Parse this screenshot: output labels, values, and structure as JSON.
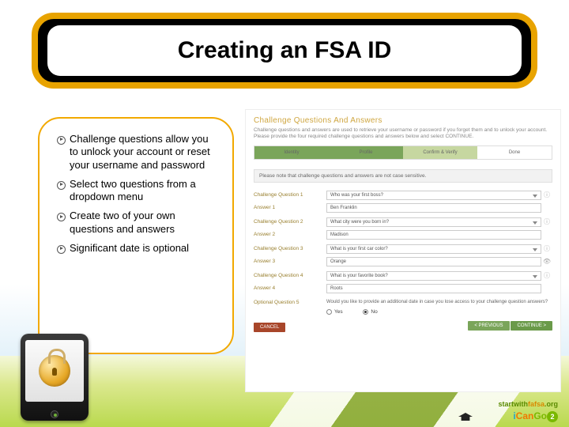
{
  "title": "Creating an FSA ID",
  "bullets": [
    "Challenge questions allow you to unlock your account or reset your username and password",
    "Select two questions from a dropdown menu",
    "Create two of your own questions and answers",
    "Significant date is optional"
  ],
  "panel": {
    "heading": "Challenge Questions And Answers",
    "blurb": "Challenge questions and answers are used to retrieve your username or password if you forget them and to unlock your account. Please provide the four required challenge questions and answers below and select CONTINUE.",
    "steps": [
      "Identity",
      "Profile",
      "Confirm & Verify",
      "Done"
    ],
    "note": "Please note that challenge questions and answers are not case sensitive.",
    "groups": [
      {
        "qlabel": "Challenge Question 1",
        "qval": "Who was your first boss?",
        "alabel": "Answer 1",
        "aval": "Ben Franklin"
      },
      {
        "qlabel": "Challenge Question 2",
        "qval": "What city were you born in?",
        "alabel": "Answer 2",
        "aval": "Madison"
      },
      {
        "qlabel": "Challenge Question 3",
        "qval": "What is your first car color?",
        "alabel": "Answer 3",
        "aval": "Orange"
      },
      {
        "qlabel": "Challenge Question 4",
        "qval": "What is your favorite book?",
        "alabel": "Answer 4",
        "aval": "Roots"
      }
    ],
    "optional": {
      "label": "Optional Question 5",
      "prompt": "Would you like to provide an additional date in case you lose access to your challenge question answers?",
      "yes": "Yes",
      "no": "No"
    },
    "buttons": {
      "cancel": "CANCEL",
      "prev": "< PREVIOUS",
      "next": "CONTINUE >"
    }
  },
  "logos": {
    "l1a": "startwith",
    "l1b": "fafsa",
    "l1c": ".org",
    "i": "i",
    "can": "Can",
    "go": "Go",
    "two": "2"
  }
}
